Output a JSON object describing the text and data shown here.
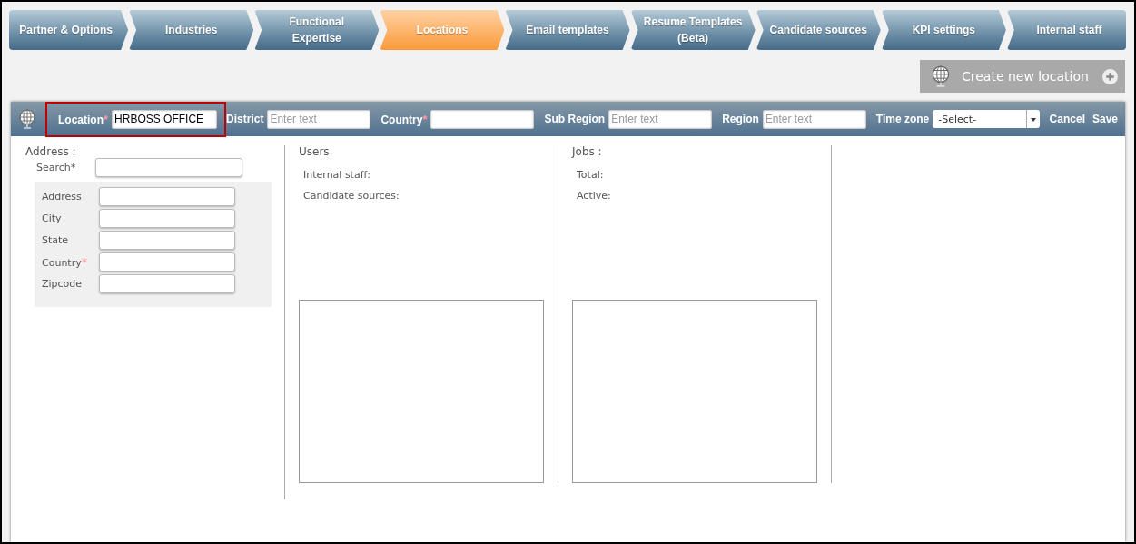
{
  "steps": [
    {
      "label": "Partner & Options",
      "selected": false
    },
    {
      "label": "Industries",
      "selected": false
    },
    {
      "label": "Functional Expertise",
      "selected": false
    },
    {
      "label": "Locations",
      "selected": true
    },
    {
      "label": "Email templates",
      "selected": false
    },
    {
      "label": "Resume Templates (Beta)",
      "selected": false
    },
    {
      "label": "Candidate sources",
      "selected": false
    },
    {
      "label": "KPI settings",
      "selected": false
    },
    {
      "label": "Internal staff",
      "selected": false
    }
  ],
  "create_button": {
    "label": "Create new location"
  },
  "header": {
    "fields": [
      {
        "kind": "text",
        "label": "Location",
        "mark": "*",
        "value": "HRBOSS OFFICE",
        "highlighted": true
      },
      {
        "kind": "text",
        "label": "District",
        "placeholder": "Enter text",
        "highlighted": false
      },
      {
        "kind": "text",
        "label": "Country",
        "mark": "*",
        "highlighted": false
      },
      {
        "kind": "text",
        "label": "Sub Region",
        "placeholder": "Enter text",
        "highlighted": false
      },
      {
        "kind": "text",
        "label": "Region",
        "placeholder": "Enter text",
        "highlighted": false
      },
      {
        "kind": "select",
        "label": "Time zone",
        "value": "-Select-",
        "highlighted": false
      }
    ],
    "actions": [
      "Cancel",
      "Save"
    ]
  },
  "address": {
    "title": "Address :",
    "search": {
      "label": "Search",
      "mark": "*"
    },
    "fields": [
      {
        "label": "Address"
      },
      {
        "label": "City"
      },
      {
        "label": "State"
      },
      {
        "label": "Country",
        "mark": "*"
      },
      {
        "label": "Zipcode"
      }
    ]
  },
  "users": {
    "title": "Users",
    "items": [
      "Internal staff:",
      "Candidate sources:"
    ]
  },
  "jobs": {
    "title": "Jobs :",
    "items": [
      "Total:",
      "Active:"
    ]
  }
}
